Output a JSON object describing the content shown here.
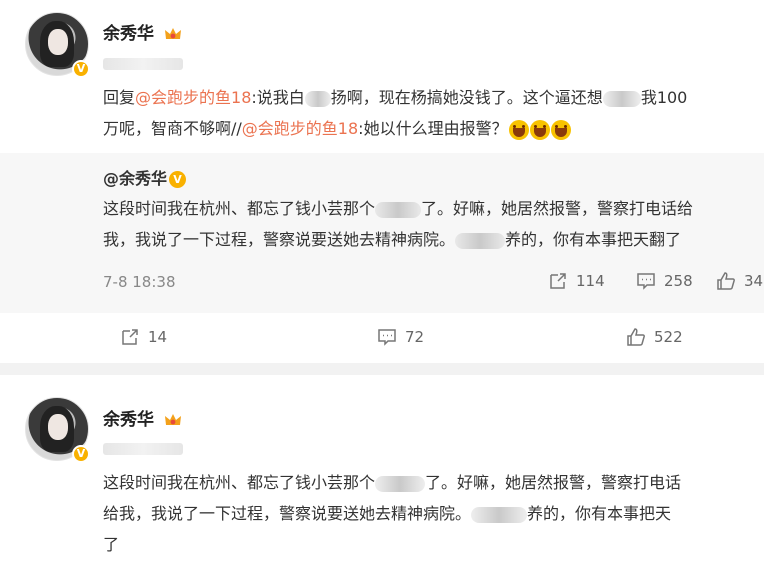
{
  "post1": {
    "author": "余秀华",
    "reply_prefix": "回复",
    "mention1": "@会跑步的鱼18",
    "text_a": ":说我白",
    "text_b": "扬啊，现在杨搞她没钱了。这个逼还想",
    "text_c": "我100",
    "text_d": "万呢，智商不够啊//",
    "mention2": "@会跑步的鱼18",
    "text_e": ":她以什么理由报警？",
    "quote": {
      "author": "@余秀华",
      "line1_a": "这段时间我在杭州、都忘了钱小芸那个",
      "line1_b": "了。好嘛，她居然报警，警察打电话给",
      "line2_a": "我，我说了一下过程，警察说要送她去精神病院。",
      "line2_b": "养的，你有本事把天翻了",
      "time": "7-8 18:38",
      "repost_count": "114",
      "comment_count": "258",
      "like_count": "34"
    },
    "repost_count": "14",
    "comment_count": "72",
    "like_count": "522"
  },
  "post2": {
    "author": "余秀华",
    "line1_a": "这段时间我在杭州、都忘了钱小芸那个",
    "line1_b": "了。好嘛，她居然报警，警察打电话",
    "line2_a": "给我，我说了一下过程，警察说要送她去精神病院。",
    "line2_b": "养的，你有本事把天",
    "line3": "了"
  },
  "icons": {
    "verified": "verified-v-icon",
    "crown": "crown-icon",
    "repost": "repost-icon",
    "comment": "comment-icon",
    "like": "thumbs-up-icon",
    "laugh": "laugh-emoji-icon"
  },
  "colors": {
    "mention": "#eb7350",
    "verified": "#f9b100",
    "background": "#f2f2f2"
  }
}
